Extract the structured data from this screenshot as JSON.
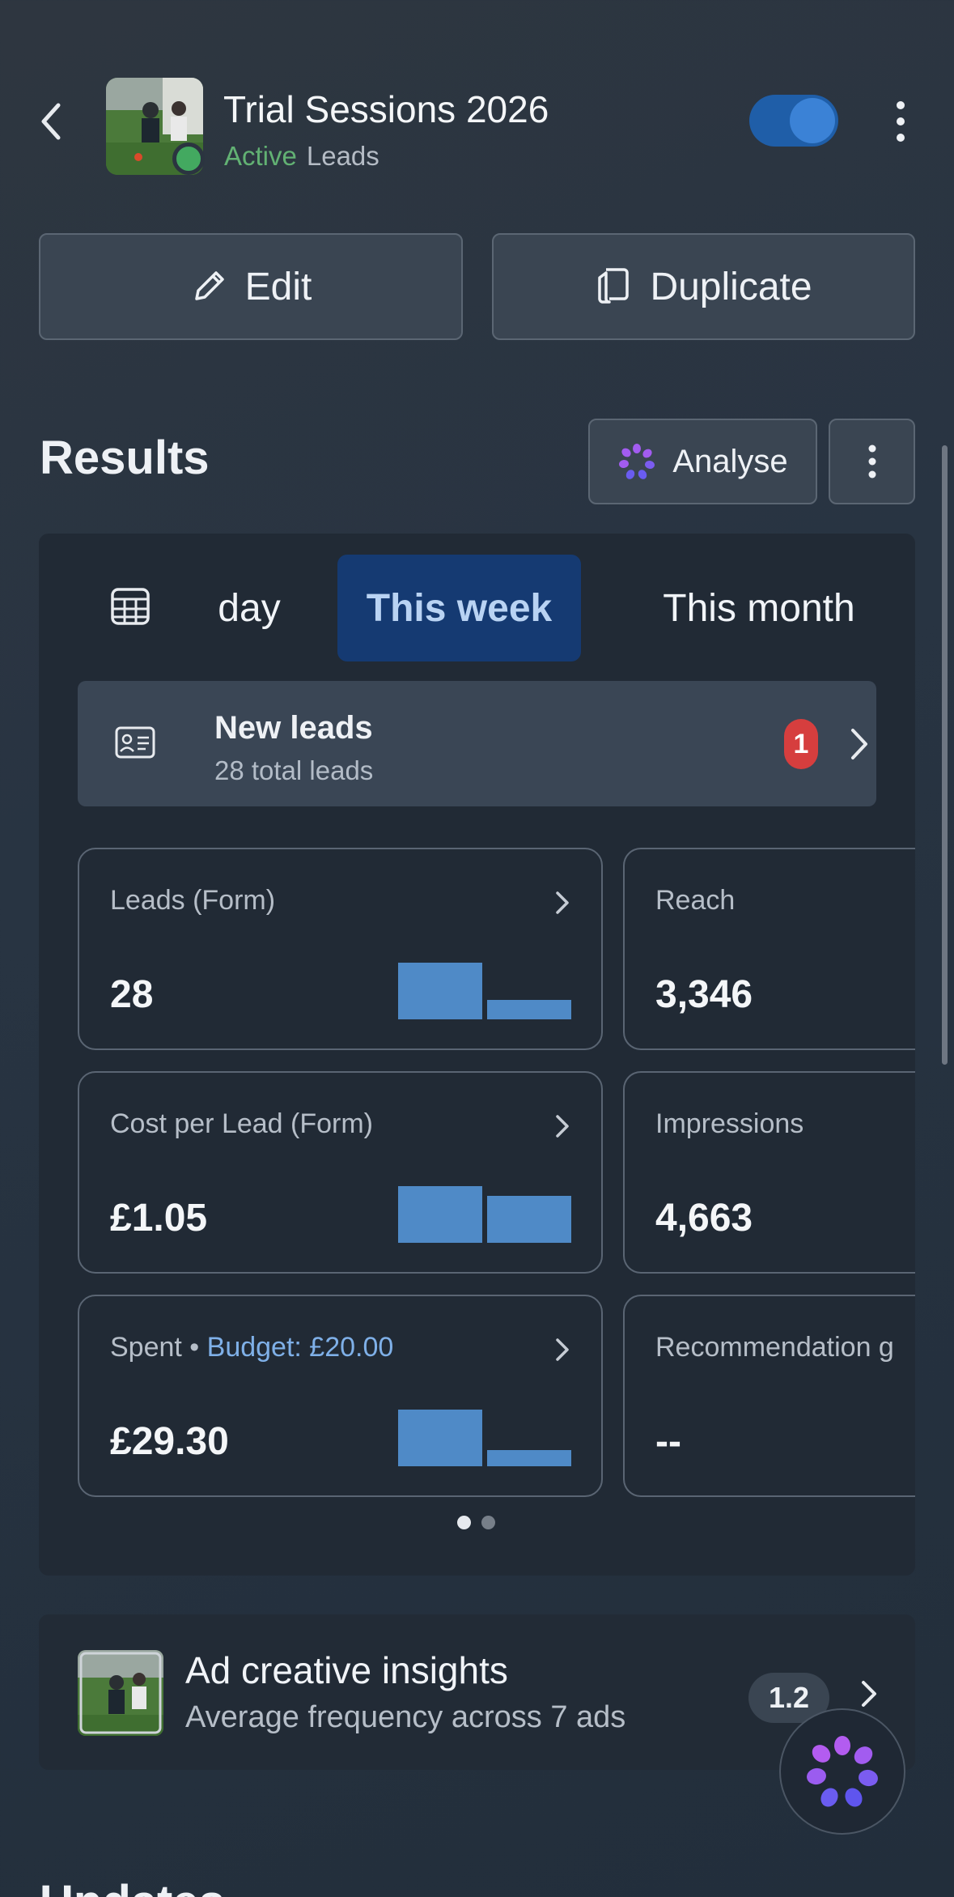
{
  "header": {
    "title": "Trial Sessions 2026",
    "status": "Active",
    "objective": "Leads",
    "toggle_on": true
  },
  "actions": {
    "edit_label": "Edit",
    "duplicate_label": "Duplicate"
  },
  "results": {
    "title": "Results",
    "analyse_label": "Analyse",
    "tabs": [
      {
        "label": "day",
        "active": false
      },
      {
        "label": "This week",
        "active": true
      },
      {
        "label": "This month",
        "active": false
      }
    ],
    "new_leads": {
      "title": "New leads",
      "subtitle": "28 total leads",
      "badge": "1"
    },
    "cards": [
      {
        "label": "Leads (Form)",
        "value": "28"
      },
      {
        "label": "Reach",
        "value": "3,346"
      },
      {
        "label": "Cost per Lead (Form)",
        "value": "£1.05"
      },
      {
        "label": "Impressions",
        "value": "4,663"
      },
      {
        "label": "Spent",
        "budget": "Budget: £20.00",
        "value": "£29.30"
      },
      {
        "label": "Recommendation g",
        "value": "--"
      }
    ],
    "page_dots": 2,
    "current_page": 1
  },
  "insights": {
    "title": "Ad creative insights",
    "subtitle": "Average frequency across 7 ads",
    "badge": "1.2"
  },
  "next_section_peek": "Updates",
  "colors": {
    "accent": "#3b82d6",
    "active_green": "#62b173",
    "badge_red": "#d63e3e",
    "bar_blue": "#4f8ac7",
    "link_blue": "#7fb0e8"
  }
}
